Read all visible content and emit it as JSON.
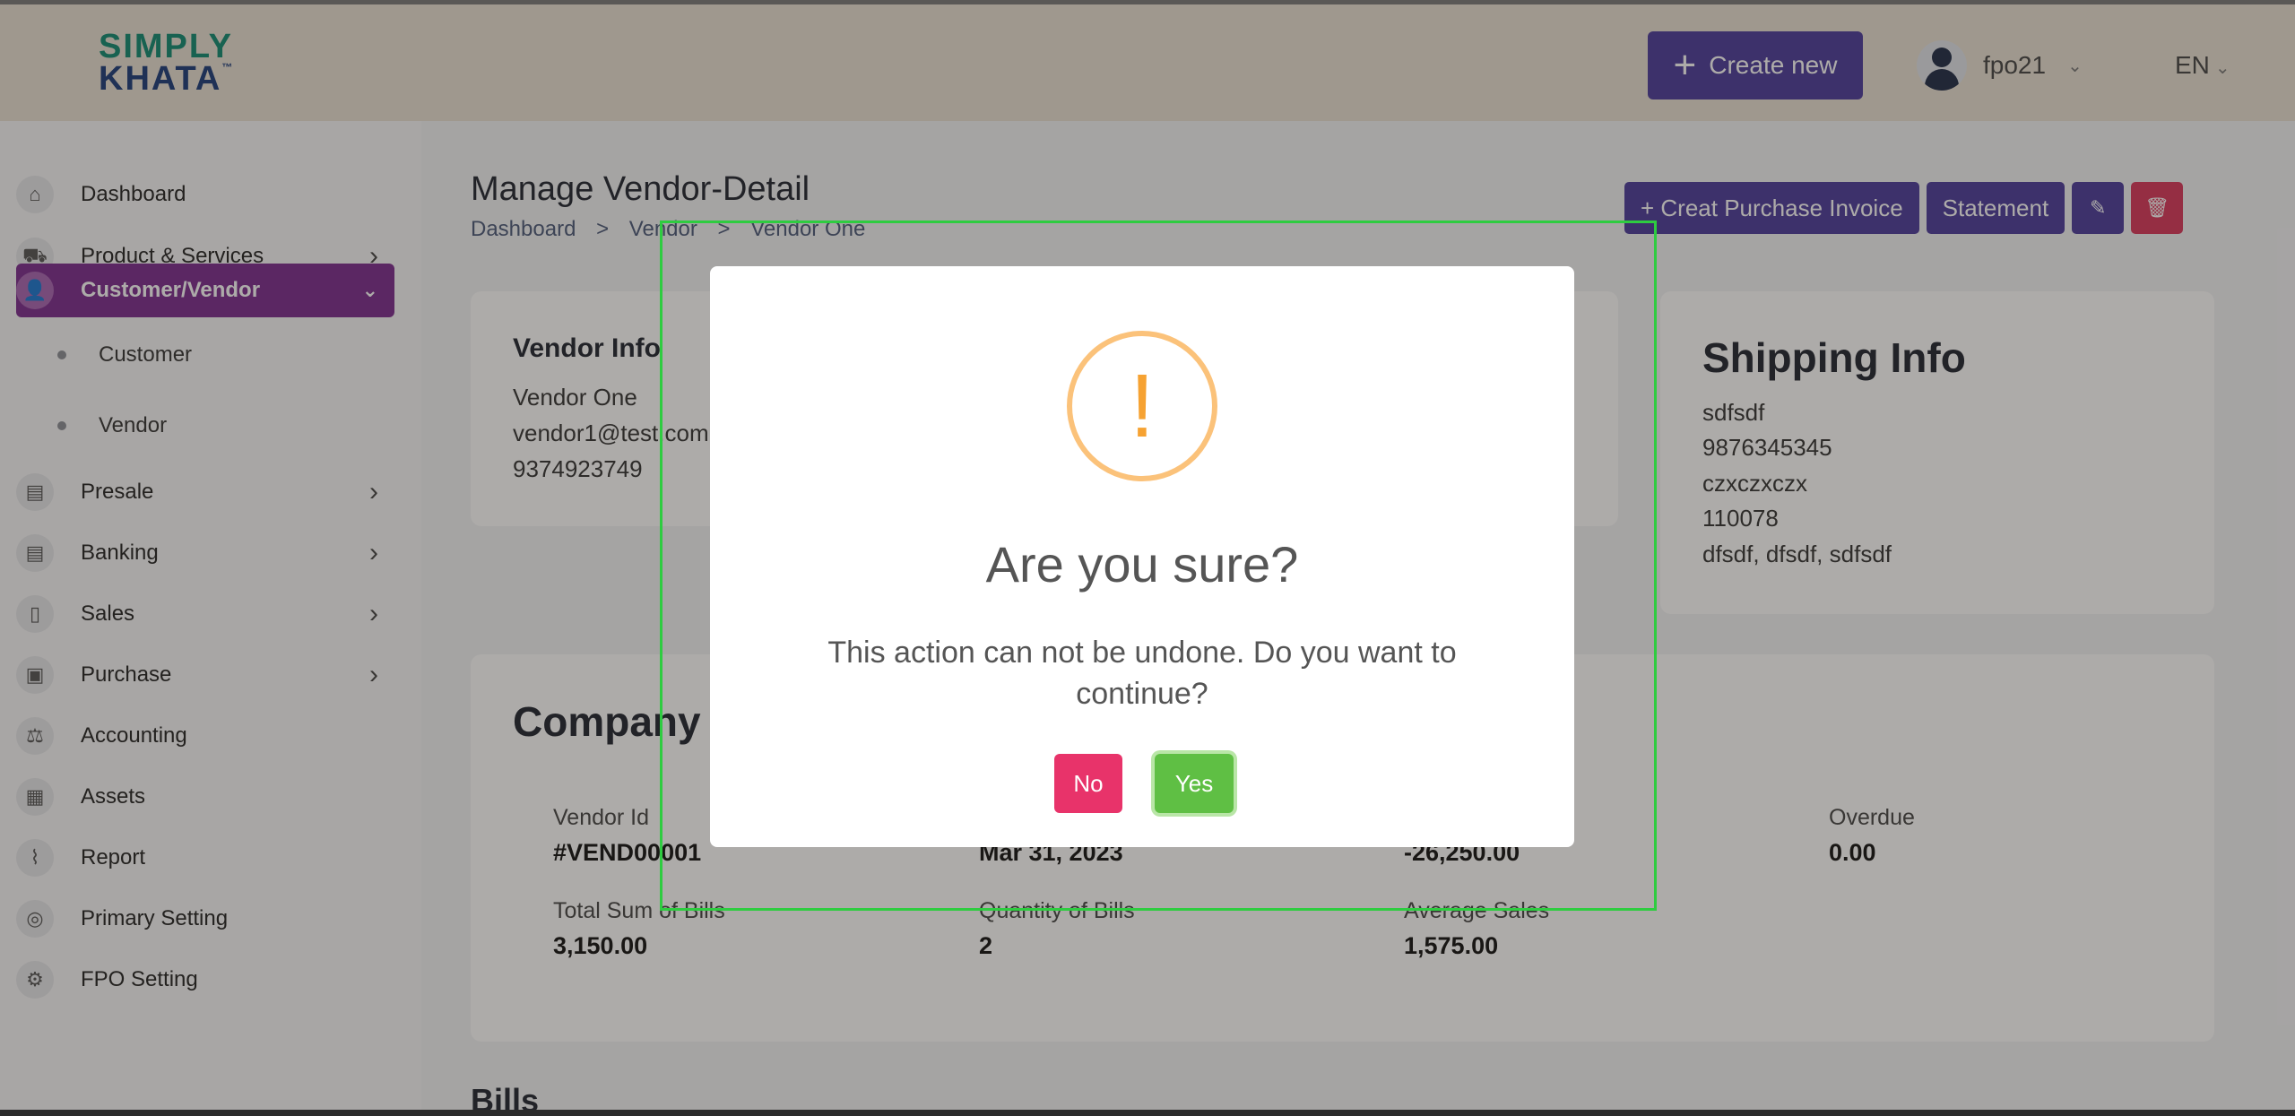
{
  "header": {
    "logo_line1": "SIMPLY",
    "logo_line2": "KHATA",
    "logo_tm": "™",
    "create_label": "Create new",
    "user_name": "fpo21",
    "language": "EN"
  },
  "sidebar": {
    "items": [
      {
        "label": "Dashboard"
      },
      {
        "label": "Product & Services"
      },
      {
        "label": "Customer/Vendor"
      },
      {
        "label": "Presale"
      },
      {
        "label": "Banking"
      },
      {
        "label": "Sales"
      },
      {
        "label": "Purchase"
      },
      {
        "label": "Accounting"
      },
      {
        "label": "Assets"
      },
      {
        "label": "Report"
      },
      {
        "label": "Primary Setting"
      },
      {
        "label": "FPO Setting"
      }
    ],
    "sub_items": [
      {
        "label": "Customer"
      },
      {
        "label": "Vendor"
      }
    ]
  },
  "page": {
    "title": "Manage Vendor-Detail",
    "breadcrumb": [
      "Dashboard",
      ">",
      "Vendor",
      ">",
      "Vendor One"
    ],
    "actions": {
      "purchase_invoice": "+ Creat Purchase Invoice",
      "statement": "Statement"
    }
  },
  "vendor_info": {
    "title": "Vendor Info",
    "name": "Vendor One",
    "email": "vendor1@test.com",
    "phone": "9374923749"
  },
  "shipping_info": {
    "title": "Shipping Info",
    "lines": [
      "sdfsdf",
      "9876345345",
      "czxczxczx",
      "110078",
      "dfsdf, dfsdf, sdfsdf"
    ]
  },
  "company": {
    "title": "Company Info",
    "vendor_id_label": "Vendor Id",
    "vendor_id_value": "#VEND00001",
    "date_value": "Mar 31, 2023",
    "balance_value": "-26,250.00",
    "overdue_label": "Overdue",
    "overdue_value": "0.00",
    "total_bills_label": "Total Sum of Bills",
    "total_bills_value": "3,150.00",
    "qty_bills_label": "Quantity of Bills",
    "qty_bills_value": "2",
    "avg_sales_label": "Average Sales",
    "avg_sales_value": "1,575.00"
  },
  "bills_title": "Bills",
  "modal": {
    "icon": "!",
    "title": "Are you sure?",
    "text": "This action can not be undone. Do you want to continue?",
    "no_label": "No",
    "yes_label": "Yes"
  },
  "colors": {
    "primary": "#4b3b9c",
    "active_nav": "#7b2a8f",
    "danger": "#d9365b",
    "warning": "#f6a232",
    "no_button": "#e8336a",
    "yes_button": "#5fbf44",
    "highlight": "#2ecc40"
  }
}
